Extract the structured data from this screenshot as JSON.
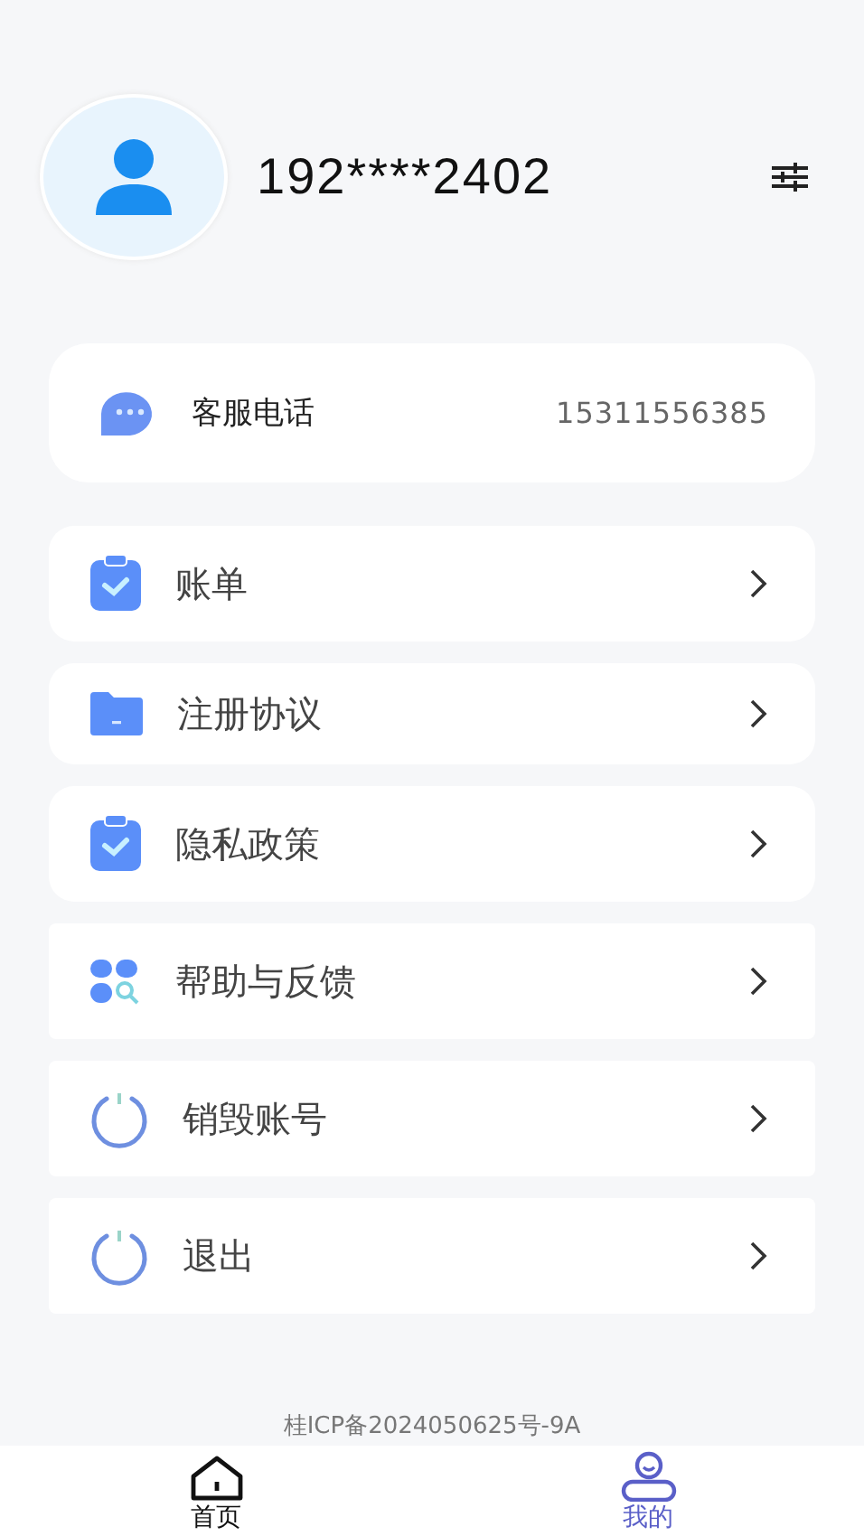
{
  "profile": {
    "phone": "192****2402"
  },
  "service": {
    "label": "客服电话",
    "number": "15311556385"
  },
  "menu": [
    {
      "label": "账单"
    },
    {
      "label": "注册协议"
    },
    {
      "label": "隐私政策"
    },
    {
      "label": "帮助与反馈"
    },
    {
      "label": "销毁账号"
    },
    {
      "label": "退出"
    }
  ],
  "footer": "桂ICP备2024050625号-9A",
  "tabs": [
    {
      "label": "首页",
      "selected": false
    },
    {
      "label": "我的",
      "selected": true
    }
  ]
}
